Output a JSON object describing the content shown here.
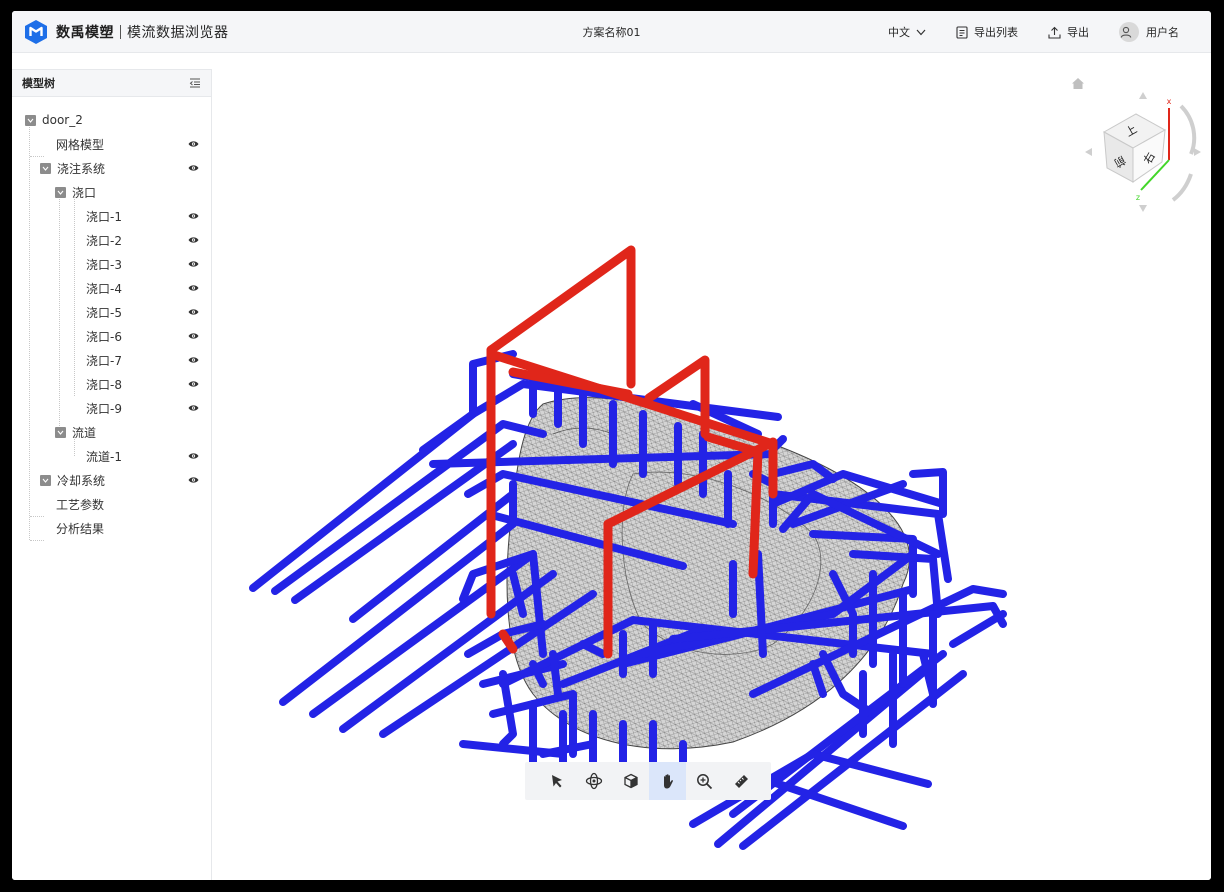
{
  "header": {
    "brand": "数禹模塑",
    "app_title": "模流数据浏览器",
    "project_name": "方案名称01",
    "language": "中文",
    "export_list": "导出列表",
    "export": "导出",
    "username": "用户名"
  },
  "sidebar": {
    "title": "模型树",
    "tree": {
      "root": "door_2",
      "mesh_model": "网格模型",
      "gating_system": "浇注系统",
      "gate_group": "浇口",
      "gates": [
        "浇口-1",
        "浇口-2",
        "浇口-3",
        "浇口-4",
        "浇口-5",
        "浇口-6",
        "浇口-7",
        "浇口-8",
        "浇口-9"
      ],
      "runner_group": "流道",
      "runner_1": "流道-1",
      "cooling_system": "冷却系统",
      "process_params": "工艺参数",
      "analysis_results": "分析结果"
    }
  },
  "navcube": {
    "face_top": "上",
    "face_front": "前",
    "face_side": "右",
    "axis_x": "x",
    "axis_z": "z"
  },
  "toolbar": {
    "active_tool": "pan",
    "tools": [
      "select-tool",
      "rotate-tool",
      "view-cube-tool",
      "pan-tool",
      "zoom-tool",
      "measure-tool"
    ]
  },
  "colors": {
    "brand_blue": "#1e6fe8",
    "cooling_channel": "#2323e6",
    "runner_red": "#e0261a",
    "active_tool_bg": "#dbe6fa"
  }
}
